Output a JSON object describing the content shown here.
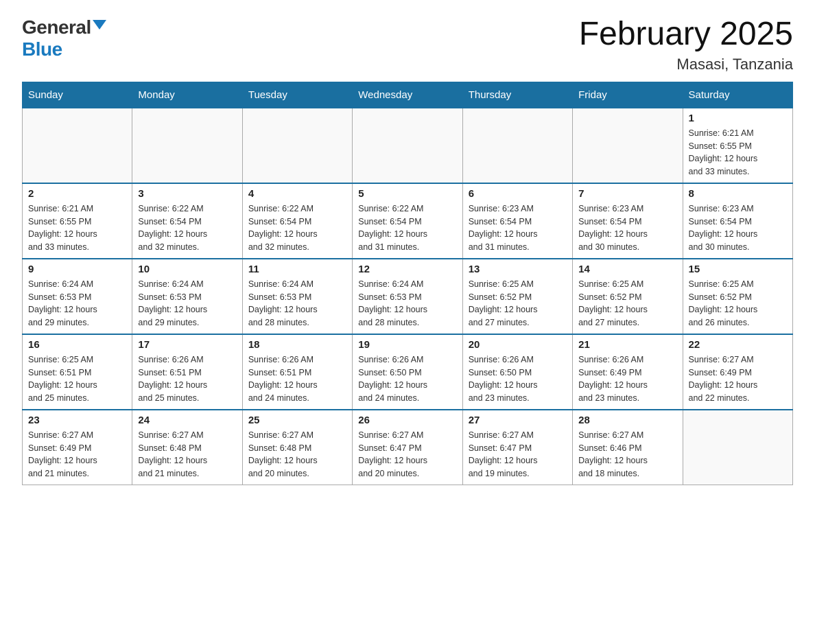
{
  "logo": {
    "general": "General",
    "blue": "Blue"
  },
  "title": {
    "month": "February 2025",
    "location": "Masasi, Tanzania"
  },
  "days_of_week": [
    "Sunday",
    "Monday",
    "Tuesday",
    "Wednesday",
    "Thursday",
    "Friday",
    "Saturday"
  ],
  "weeks": [
    [
      {
        "day": "",
        "info": ""
      },
      {
        "day": "",
        "info": ""
      },
      {
        "day": "",
        "info": ""
      },
      {
        "day": "",
        "info": ""
      },
      {
        "day": "",
        "info": ""
      },
      {
        "day": "",
        "info": ""
      },
      {
        "day": "1",
        "info": "Sunrise: 6:21 AM\nSunset: 6:55 PM\nDaylight: 12 hours\nand 33 minutes."
      }
    ],
    [
      {
        "day": "2",
        "info": "Sunrise: 6:21 AM\nSunset: 6:55 PM\nDaylight: 12 hours\nand 33 minutes."
      },
      {
        "day": "3",
        "info": "Sunrise: 6:22 AM\nSunset: 6:54 PM\nDaylight: 12 hours\nand 32 minutes."
      },
      {
        "day": "4",
        "info": "Sunrise: 6:22 AM\nSunset: 6:54 PM\nDaylight: 12 hours\nand 32 minutes."
      },
      {
        "day": "5",
        "info": "Sunrise: 6:22 AM\nSunset: 6:54 PM\nDaylight: 12 hours\nand 31 minutes."
      },
      {
        "day": "6",
        "info": "Sunrise: 6:23 AM\nSunset: 6:54 PM\nDaylight: 12 hours\nand 31 minutes."
      },
      {
        "day": "7",
        "info": "Sunrise: 6:23 AM\nSunset: 6:54 PM\nDaylight: 12 hours\nand 30 minutes."
      },
      {
        "day": "8",
        "info": "Sunrise: 6:23 AM\nSunset: 6:54 PM\nDaylight: 12 hours\nand 30 minutes."
      }
    ],
    [
      {
        "day": "9",
        "info": "Sunrise: 6:24 AM\nSunset: 6:53 PM\nDaylight: 12 hours\nand 29 minutes."
      },
      {
        "day": "10",
        "info": "Sunrise: 6:24 AM\nSunset: 6:53 PM\nDaylight: 12 hours\nand 29 minutes."
      },
      {
        "day": "11",
        "info": "Sunrise: 6:24 AM\nSunset: 6:53 PM\nDaylight: 12 hours\nand 28 minutes."
      },
      {
        "day": "12",
        "info": "Sunrise: 6:24 AM\nSunset: 6:53 PM\nDaylight: 12 hours\nand 28 minutes."
      },
      {
        "day": "13",
        "info": "Sunrise: 6:25 AM\nSunset: 6:52 PM\nDaylight: 12 hours\nand 27 minutes."
      },
      {
        "day": "14",
        "info": "Sunrise: 6:25 AM\nSunset: 6:52 PM\nDaylight: 12 hours\nand 27 minutes."
      },
      {
        "day": "15",
        "info": "Sunrise: 6:25 AM\nSunset: 6:52 PM\nDaylight: 12 hours\nand 26 minutes."
      }
    ],
    [
      {
        "day": "16",
        "info": "Sunrise: 6:25 AM\nSunset: 6:51 PM\nDaylight: 12 hours\nand 25 minutes."
      },
      {
        "day": "17",
        "info": "Sunrise: 6:26 AM\nSunset: 6:51 PM\nDaylight: 12 hours\nand 25 minutes."
      },
      {
        "day": "18",
        "info": "Sunrise: 6:26 AM\nSunset: 6:51 PM\nDaylight: 12 hours\nand 24 minutes."
      },
      {
        "day": "19",
        "info": "Sunrise: 6:26 AM\nSunset: 6:50 PM\nDaylight: 12 hours\nand 24 minutes."
      },
      {
        "day": "20",
        "info": "Sunrise: 6:26 AM\nSunset: 6:50 PM\nDaylight: 12 hours\nand 23 minutes."
      },
      {
        "day": "21",
        "info": "Sunrise: 6:26 AM\nSunset: 6:49 PM\nDaylight: 12 hours\nand 23 minutes."
      },
      {
        "day": "22",
        "info": "Sunrise: 6:27 AM\nSunset: 6:49 PM\nDaylight: 12 hours\nand 22 minutes."
      }
    ],
    [
      {
        "day": "23",
        "info": "Sunrise: 6:27 AM\nSunset: 6:49 PM\nDaylight: 12 hours\nand 21 minutes."
      },
      {
        "day": "24",
        "info": "Sunrise: 6:27 AM\nSunset: 6:48 PM\nDaylight: 12 hours\nand 21 minutes."
      },
      {
        "day": "25",
        "info": "Sunrise: 6:27 AM\nSunset: 6:48 PM\nDaylight: 12 hours\nand 20 minutes."
      },
      {
        "day": "26",
        "info": "Sunrise: 6:27 AM\nSunset: 6:47 PM\nDaylight: 12 hours\nand 20 minutes."
      },
      {
        "day": "27",
        "info": "Sunrise: 6:27 AM\nSunset: 6:47 PM\nDaylight: 12 hours\nand 19 minutes."
      },
      {
        "day": "28",
        "info": "Sunrise: 6:27 AM\nSunset: 6:46 PM\nDaylight: 12 hours\nand 18 minutes."
      },
      {
        "day": "",
        "info": ""
      }
    ]
  ]
}
